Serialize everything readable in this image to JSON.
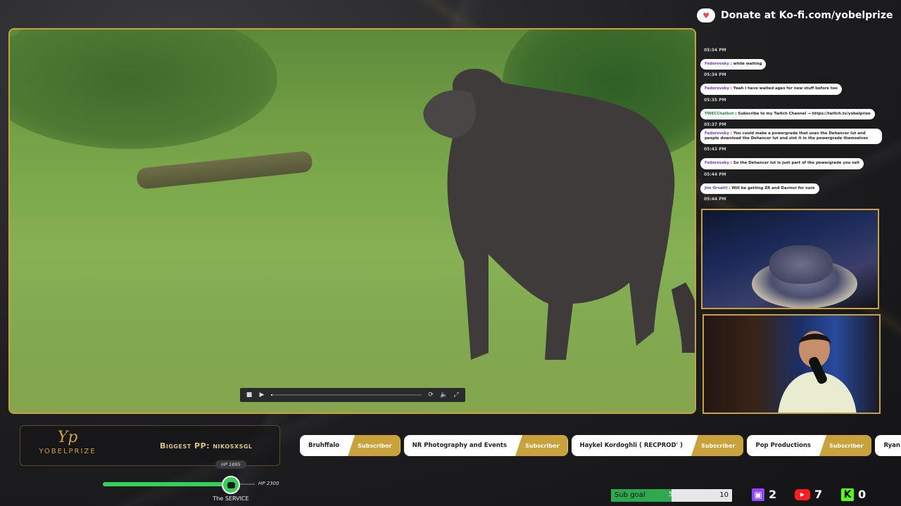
{
  "donate": {
    "text": "Donate at Ko-fi.com/yobelprize",
    "icon": "kofi-cup-icon"
  },
  "chat": {
    "messages": [
      {
        "time": "05:34 PM",
        "user": "Fedorovsky",
        "user_color": "#7a2fc4",
        "text": "while waiting"
      },
      {
        "time": "05:34 PM",
        "user": "Fedorovsky",
        "user_color": "#7a2fc4",
        "text": "Yeah I have waited ages for new stuff before too"
      },
      {
        "time": "05:35 PM",
        "user": "TWECChatbot",
        "user_color": "#1d8a3c",
        "text": "Subscribe to my Twitch Channel → https://twitch.tv/yobelprize"
      },
      {
        "time": "05:37 PM",
        "user": "Fedorovsky",
        "user_color": "#7a2fc4",
        "text": "You could make a powergrade that uses the Dehancer lut and people download the Dehancer lut and slot it in the powergrade themselves"
      },
      {
        "time": "05:43 PM",
        "user": "Fedorovsky",
        "user_color": "#7a2fc4",
        "text": "So the Dehancer lut is just part of the powergrade you sell"
      },
      {
        "time": "05:44 PM",
        "user": "Jim Orsatti",
        "user_color": "#6b3fc0",
        "text": "Will be getting ZR and Davinci for sure"
      }
    ],
    "last_time": "05:44 PM"
  },
  "brand": {
    "logo_mark": "Yp",
    "logo_text": "YOBELPRIZE",
    "biggest_pp": "Biggest PP: nikosxsgl"
  },
  "subscribers": [
    {
      "name": "Bruhffalo",
      "tag": "Subscriber"
    },
    {
      "name": "NR Photography and Events",
      "tag": "Subscriber"
    },
    {
      "name": "Haykel Kordoghli ( RECPROD' )",
      "tag": "Subscriber"
    },
    {
      "name": "Pop Productions",
      "tag": "Subscriber"
    },
    {
      "name": "Ryan Priest",
      "tag": ""
    }
  ],
  "hp": {
    "current_label": "HP 1895",
    "max_label": "HP 2300",
    "fraction": 0.82,
    "name": "The SERVICE",
    "icon": "discord-icon",
    "color": "#35d05a"
  },
  "subgoal": {
    "label": "Sub goal",
    "current": "5",
    "max": "10",
    "color": "#2fa84f"
  },
  "platforms": [
    {
      "name": "twitch",
      "icon": "twitch-icon",
      "count": "2"
    },
    {
      "name": "youtube",
      "icon": "youtube-icon",
      "count": "7"
    },
    {
      "name": "kick",
      "icon": "kick-icon",
      "count": "0"
    }
  ],
  "player": {
    "controls": [
      "stop-icon",
      "play-icon",
      "loop-icon",
      "volume-icon",
      "fullscreen-icon"
    ]
  },
  "colors": {
    "accent": "#c9a23c"
  }
}
